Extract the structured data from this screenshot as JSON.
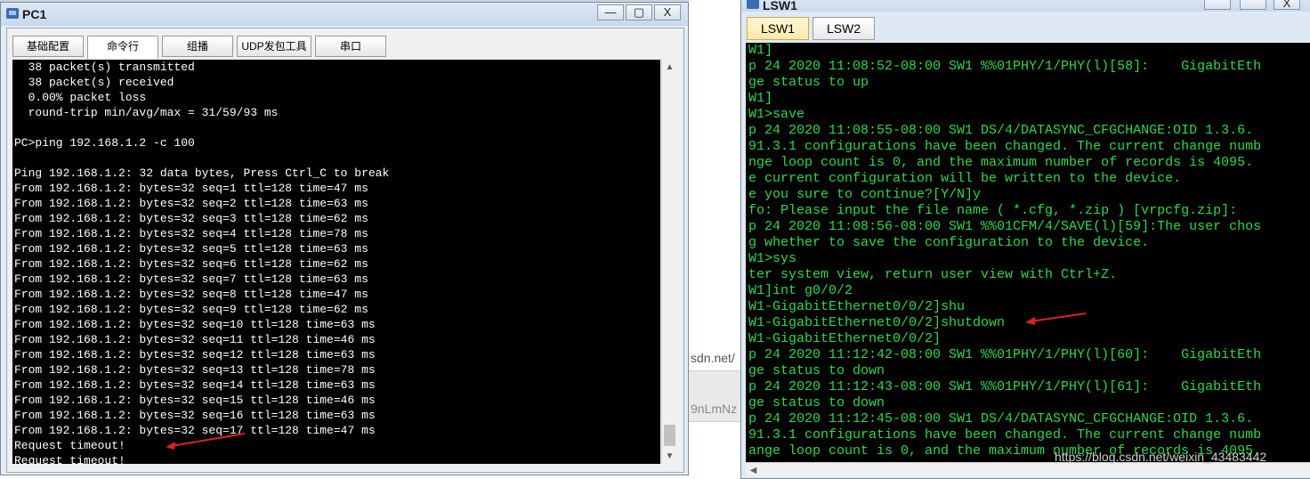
{
  "background": {
    "peek_text_1": "sdn.net/",
    "peek_text_2": "9nLmNz"
  },
  "pc1": {
    "title": "PC1",
    "controls": {
      "minimize": "—",
      "maximize": "▢",
      "close": "X"
    },
    "tabs": [
      {
        "label": "基础配置"
      },
      {
        "label": "命令行"
      },
      {
        "label": "组播"
      },
      {
        "label": "UDP发包工具"
      },
      {
        "label": "串口"
      }
    ],
    "active_tab": "命令行",
    "terminal_lines": [
      "  38 packet(s) transmitted",
      "  38 packet(s) received",
      "  0.00% packet loss",
      "  round-trip min/avg/max = 31/59/93 ms",
      "",
      "PC>ping 192.168.1.2 -c 100",
      "",
      "Ping 192.168.1.2: 32 data bytes, Press Ctrl_C to break",
      "From 192.168.1.2: bytes=32 seq=1 ttl=128 time=47 ms",
      "From 192.168.1.2: bytes=32 seq=2 ttl=128 time=63 ms",
      "From 192.168.1.2: bytes=32 seq=3 ttl=128 time=62 ms",
      "From 192.168.1.2: bytes=32 seq=4 ttl=128 time=78 ms",
      "From 192.168.1.2: bytes=32 seq=5 ttl=128 time=63 ms",
      "From 192.168.1.2: bytes=32 seq=6 ttl=128 time=62 ms",
      "From 192.168.1.2: bytes=32 seq=7 ttl=128 time=63 ms",
      "From 192.168.1.2: bytes=32 seq=8 ttl=128 time=47 ms",
      "From 192.168.1.2: bytes=32 seq=9 ttl=128 time=62 ms",
      "From 192.168.1.2: bytes=32 seq=10 ttl=128 time=63 ms",
      "From 192.168.1.2: bytes=32 seq=11 ttl=128 time=46 ms",
      "From 192.168.1.2: bytes=32 seq=12 ttl=128 time=63 ms",
      "From 192.168.1.2: bytes=32 seq=13 ttl=128 time=78 ms",
      "From 192.168.1.2: bytes=32 seq=14 ttl=128 time=63 ms",
      "From 192.168.1.2: bytes=32 seq=15 ttl=128 time=46 ms",
      "From 192.168.1.2: bytes=32 seq=16 ttl=128 time=63 ms",
      "From 192.168.1.2: bytes=32 seq=17 ttl=128 time=47 ms",
      "Request timeout!",
      "Request timeout!"
    ]
  },
  "lsw1": {
    "title": "LSW1",
    "controls": {
      "close": "X"
    },
    "tabs": [
      {
        "label": "LSW1"
      },
      {
        "label": "LSW2"
      }
    ],
    "active_tab": "LSW1",
    "terminal_lines": [
      "W1]",
      "p 24 2020 11:08:52-08:00 SW1 %%01PHY/1/PHY(l)[58]:    GigabitEth",
      "ge status to up",
      "W1]",
      "W1>save",
      "p 24 2020 11:08:55-08:00 SW1 DS/4/DATASYNC_CFGCHANGE:OID 1.3.6.",
      "91.3.1 configurations have been changed. The current change numb",
      "nge loop count is 0, and the maximum number of records is 4095.",
      "e current configuration will be written to the device.",
      "e you sure to continue?[Y/N]y",
      "fo: Please input the file name ( *.cfg, *.zip ) [vrpcfg.zip]:",
      "p 24 2020 11:08:56-08:00 SW1 %%01CFM/4/SAVE(l)[59]:The user chos",
      "g whether to save the configuration to the device.",
      "W1>sys",
      "ter system view, return user view with Ctrl+Z.",
      "W1]int g0/0/2",
      "W1-GigabitEthernet0/0/2]shu",
      "W1-GigabitEthernet0/0/2]shutdown",
      "W1-GigabitEthernet0/0/2]",
      "p 24 2020 11:12:42-08:00 SW1 %%01PHY/1/PHY(l)[60]:    GigabitEth",
      "ge status to down",
      "p 24 2020 11:12:43-08:00 SW1 %%01PHY/1/PHY(l)[61]:    GigabitEth",
      "ge status to down",
      "p 24 2020 11:12:45-08:00 SW1 DS/4/DATASYNC_CFGCHANGE:OID 1.3.6.",
      "91.3.1 configurations have been changed. The current change numb",
      "ange loop count is 0, and the maximum number of records is 4095."
    ]
  },
  "watermark": "https://blog.csdn.net/weixin_43483442",
  "colors": {
    "terminal_pc_text": "#ffffff",
    "terminal_switch_text": "#2fd84a",
    "annotation_arrow": "#e02020"
  }
}
